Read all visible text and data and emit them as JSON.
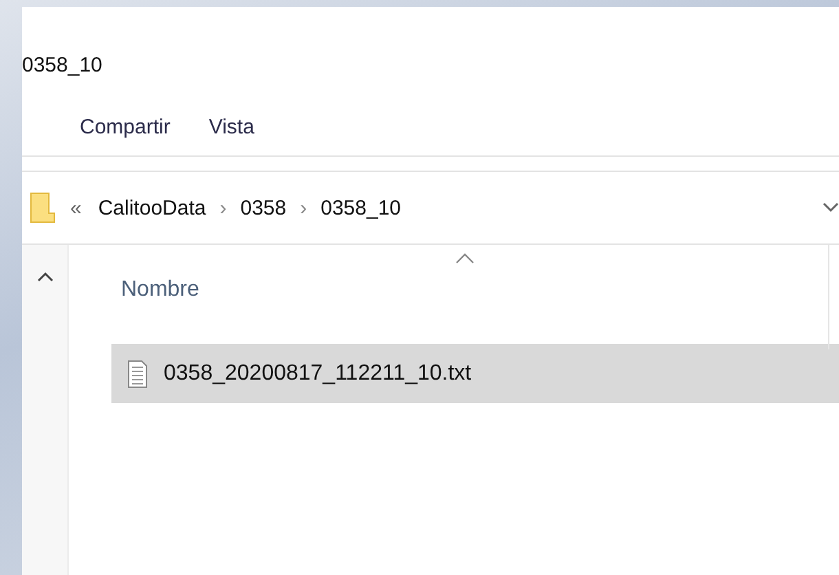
{
  "window": {
    "title": "0358_10"
  },
  "ribbon_tabs": [
    {
      "label": "Compartir",
      "selected": false
    },
    {
      "label": "Vista",
      "selected": false
    }
  ],
  "address_bar": {
    "overflow": "«",
    "path": [
      "CalitooData",
      "0358",
      "0358_10"
    ],
    "separator": "›"
  },
  "columns": [
    {
      "label": "Nombre",
      "sorted": true
    }
  ],
  "files": [
    {
      "name": "0358_20200817_112211_10.txt",
      "selected": true
    }
  ]
}
